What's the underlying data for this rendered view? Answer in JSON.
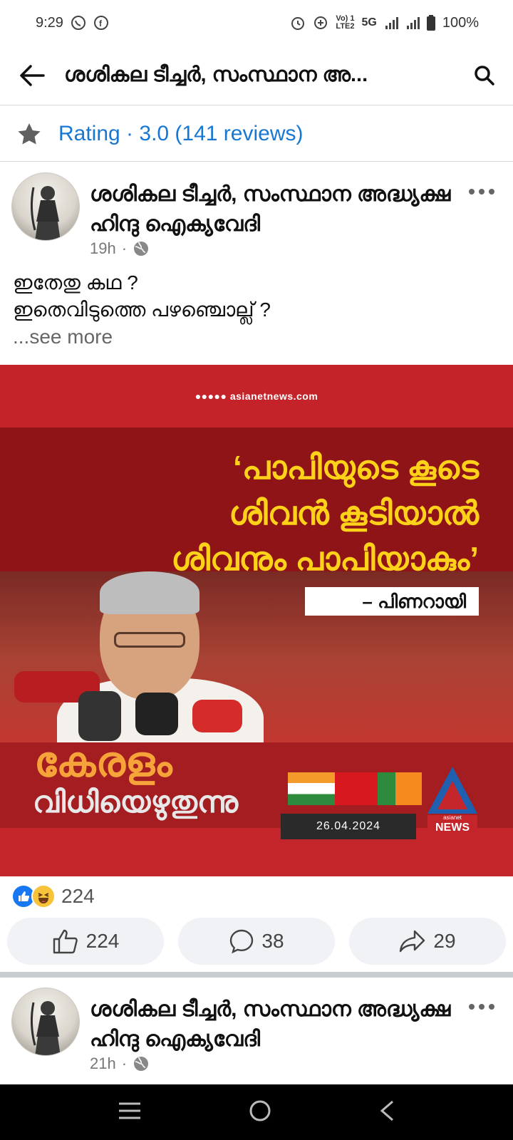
{
  "status_bar": {
    "time": "9:29",
    "network_top": "Vo) 1",
    "network_bottom": "LTE2",
    "network_type": "5G",
    "battery": "100%"
  },
  "header": {
    "title": "ശശികല ടീച്ചർ, സംസ്ഥാന അ..."
  },
  "rating": {
    "text": "Rating · 3.0 (141 reviews)"
  },
  "posts": [
    {
      "author": "ശശികല ടീച്ചർ, സംസ്ഥാന അദ്ധ്യക്ഷ ഹിന്ദു ഐക്യവേദി",
      "time": "19h",
      "text_line1": "ഇതേതു കഥ ?",
      "text_line2": "ഇതെവിടുത്തെ പഴഞ്ചൊല്ല് ?",
      "see_more": "...see more",
      "image": {
        "site": "asianetnews.com",
        "quote_line1": "‘പാപിയുടെ കൂടെ",
        "quote_line2": "ശിവൻ കൂടിയാൽ",
        "quote_line3": "ശിവനും പാപിയാകും’",
        "attribution": "– പിണറായി",
        "banner_line1": "കേരളം",
        "banner_line2": "വിധിയെഴുതുന്നു",
        "date": "26.04.2024",
        "brand_top": "asianet",
        "brand_bottom": "NEWS"
      },
      "reaction_count": "224",
      "actions": {
        "like_count": "224",
        "comment_count": "38",
        "share_count": "29"
      }
    },
    {
      "author": "ശശികല ടീച്ചർ, സംസ്ഥാന അദ്ധ്യക്ഷ ഹിന്ദു ഐക്യവേദി",
      "time": "21h"
    }
  ],
  "colors": {
    "accent_blue": "#1877d2",
    "image_red": "#c4252b",
    "quote_yellow": "#ffd21a"
  }
}
